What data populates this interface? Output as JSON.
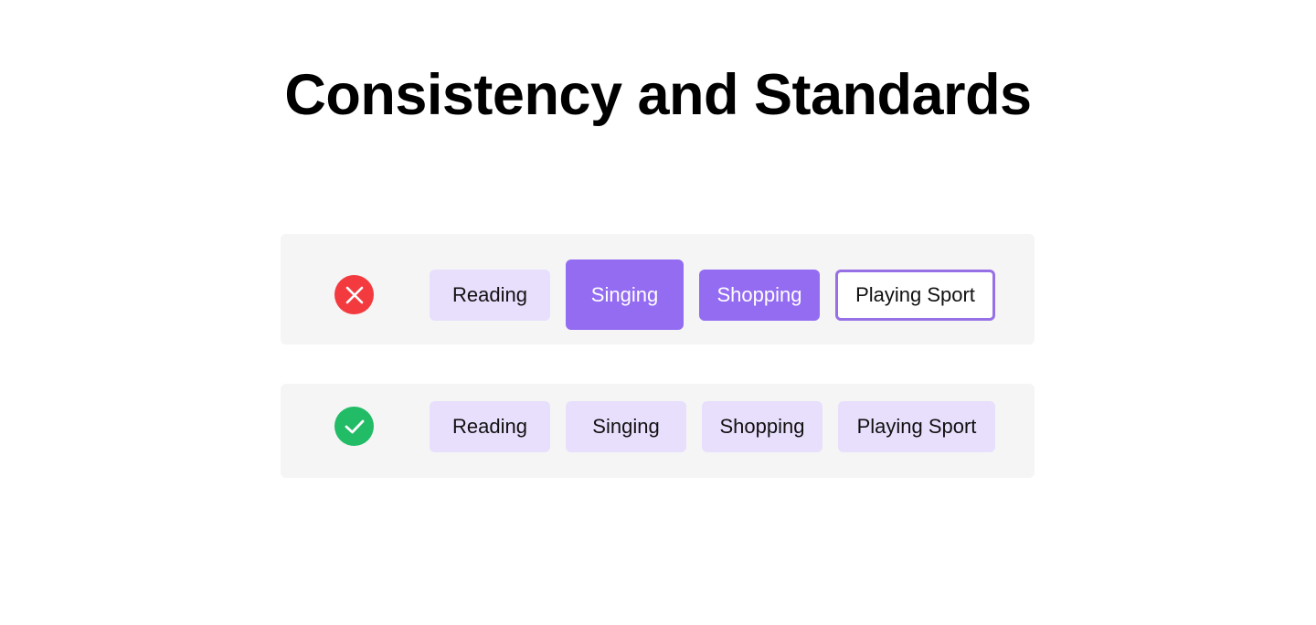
{
  "page": {
    "title": "Consistency and Standards"
  },
  "examples": [
    {
      "kind": "incorrect",
      "icon": "x-circle-icon",
      "icon_color": "#f33a3f",
      "chips": [
        {
          "label": "Reading",
          "style": "soft"
        },
        {
          "label": "Singing",
          "style": "solid-large"
        },
        {
          "label": "Shopping",
          "style": "solid"
        },
        {
          "label": "Playing Sport",
          "style": "outline"
        }
      ]
    },
    {
      "kind": "correct",
      "icon": "check-circle-icon",
      "icon_color": "#22bb66",
      "chips": [
        {
          "label": "Reading",
          "style": "soft"
        },
        {
          "label": "Singing",
          "style": "soft"
        },
        {
          "label": "Shopping",
          "style": "soft"
        },
        {
          "label": "Playing Sport",
          "style": "soft"
        }
      ]
    }
  ],
  "colors": {
    "accent": "#946cf2",
    "chip_soft": "#e8dffd",
    "panel_bg": "#f5f5f5"
  }
}
